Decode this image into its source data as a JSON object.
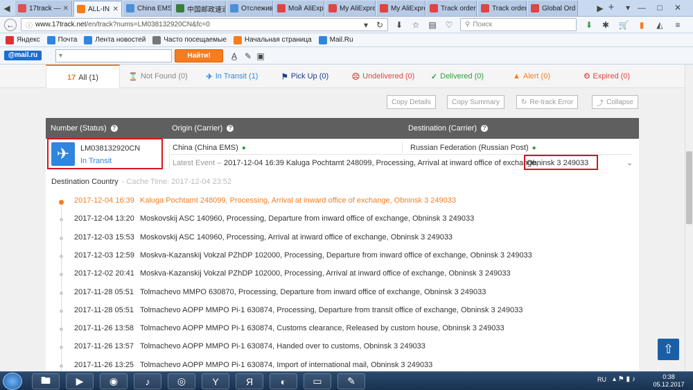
{
  "tabs": [
    {
      "label": "17track —",
      "color": "#e05050"
    },
    {
      "label": "ALL-IN",
      "color": "#f57d1f",
      "active": true
    },
    {
      "label": "China EMS",
      "color": "#4a8fd8"
    },
    {
      "label": "中国邮政速递",
      "color": "#3a7d3a"
    },
    {
      "label": "Отслежив",
      "color": "#4a8fd8"
    },
    {
      "label": "Мой AliExpress",
      "color": "#e04444"
    },
    {
      "label": "My AliExpress",
      "color": "#e04444"
    },
    {
      "label": "My AliExpress",
      "color": "#e04444"
    },
    {
      "label": "Track order",
      "color": "#e04444"
    },
    {
      "label": "Track order",
      "color": "#e04444"
    },
    {
      "label": "Global Ord",
      "color": "#e04444"
    }
  ],
  "nav": {
    "url_host": "www.17track.net",
    "url_path": "/en/track?nums=LM038132920CN&fc=0",
    "search_placeholder": "Поиск"
  },
  "bookmarks": [
    {
      "label": "Яндекс",
      "color": "#e03030"
    },
    {
      "label": "Почта",
      "color": "#2e86de"
    },
    {
      "label": "Лента новостей",
      "color": "#2e86de"
    },
    {
      "label": "Часто посещаемые",
      "color": "#777"
    },
    {
      "label": "Начальная страница",
      "color": "#f57d1f"
    },
    {
      "label": "Mail.Ru",
      "color": "#2e86de"
    }
  ],
  "mail": {
    "logo": "@mail.ru",
    "button": "Найти!"
  },
  "status_tabs": [
    {
      "label": "All (1)",
      "icon": "17-logo",
      "active": true
    },
    {
      "label": "Not Found (0)",
      "icon": "hourglass-icon",
      "color": "#888"
    },
    {
      "label": "In Transit (1)",
      "icon": "plane-icon",
      "color": "#2e86de"
    },
    {
      "label": "Pick Up (0)",
      "icon": "flag-icon",
      "color": "#1a3a8f"
    },
    {
      "label": "Undelivered (0)",
      "icon": "sad-face-icon",
      "color": "#e04444"
    },
    {
      "label": "Delivered (0)",
      "icon": "check-icon",
      "color": "#2e9d3e"
    },
    {
      "label": "Alert (0)",
      "icon": "warning-icon",
      "color": "#f57d1f"
    },
    {
      "label": "Expired (0)",
      "icon": "clock-icon",
      "color": "#e04444"
    }
  ],
  "toolbar": {
    "copy_details": "Copy Details",
    "copy_summary": "Copy Summary",
    "retrack": "Re-track Error",
    "collapse": "Collapse"
  },
  "table": {
    "col_number": "Number (Status)",
    "col_origin": "Origin (Carrier)",
    "col_destination": "Destination (Carrier)"
  },
  "item": {
    "number": "LM038132920CN",
    "status": "In Transit",
    "origin": "China (China EMS)",
    "destination": "Russian Federation (Russian Post)",
    "latest_label": "Latest Event –",
    "latest_event": "2017-12-04 16:39 Kaluga Pochtamt 248099, Processing, Arrival at inward office of exchange,",
    "latest_highlight": "Obninsk 3 249033"
  },
  "dest_country": {
    "label": "Destination Country",
    "cache": "- Cache Time: 2017-12-04 23:52"
  },
  "events": [
    {
      "time": "2017-12-04 16:39",
      "text": "Kaluga Pochtamt 248099, Processing, Arrival at inward office of exchange, Obninsk 3 249033",
      "latest": true
    },
    {
      "time": "2017-12-04 13:20",
      "text": "Moskovskij ASC 140960, Processing, Departure from inward office of exchange, Obninsk 3 249033"
    },
    {
      "time": "2017-12-03 15:53",
      "text": "Moskovskij ASC 140960, Processing, Arrival at inward office of exchange, Obninsk 3 249033"
    },
    {
      "time": "2017-12-03 12:59",
      "text": "Moskva-Kazanskij Vokzal PZhDP 102000, Processing, Departure from inward office of exchange, Obninsk 3 249033"
    },
    {
      "time": "2017-12-02 20:41",
      "text": "Moskva-Kazanskij Vokzal PZhDP 102000, Processing, Arrival at inward office of exchange, Obninsk 3 249033"
    },
    {
      "time": "2017-11-28 05:51",
      "text": "Tolmachevo MMPO 630870, Processing, Departure from inward office of exchange, Obninsk 3 249033"
    },
    {
      "time": "2017-11-28 05:51",
      "text": "Tolmachevo AOPP MMPO Pi-1 630874, Processing, Departure from transit office of exchange, Obninsk 3 249033"
    },
    {
      "time": "2017-11-26 13:58",
      "text": "Tolmachevo AOPP MMPO Pi-1 630874, Customs clearance, Released by custom house, Obninsk 3 249033"
    },
    {
      "time": "2017-11-26 13:57",
      "text": "Tolmachevo AOPP MMPO Pi-1 630874, Handed over to customs, Obninsk 3 249033"
    },
    {
      "time": "2017-11-26 13:25",
      "text": "Tolmachevo AOPP MMPO Pi-1 630874, Import of international mail, Obninsk 3 249033"
    }
  ],
  "taskbar": {
    "lang": "RU",
    "time": "0:38",
    "date": "05.12.2017"
  },
  "colors": {
    "accent": "#f57d1f",
    "transit": "#2e86de",
    "highlight_box": "#d9131b"
  }
}
